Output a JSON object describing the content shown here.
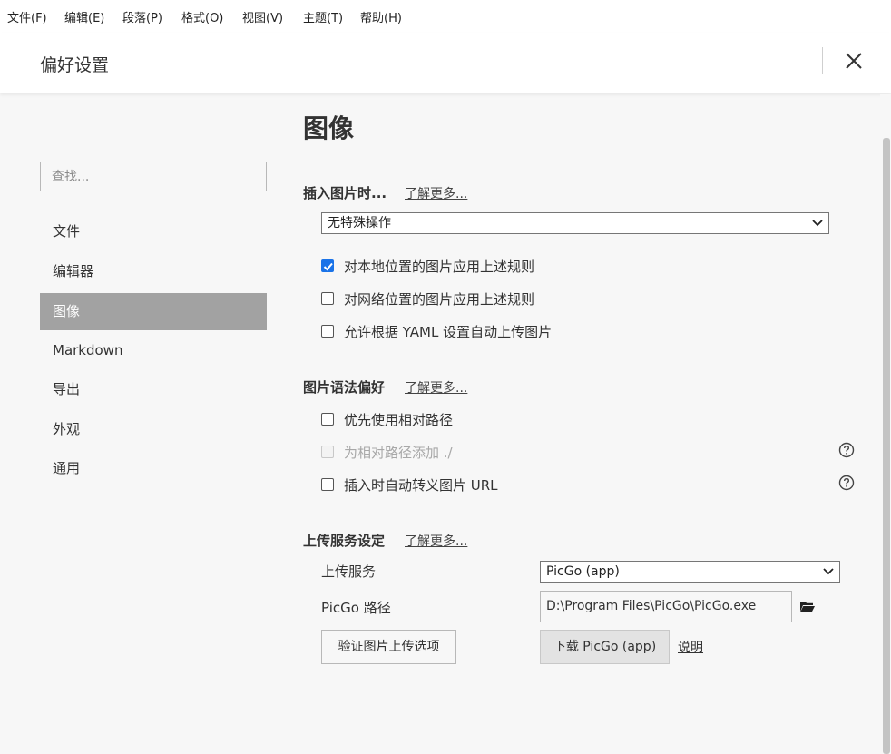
{
  "menubar": {
    "items": [
      "文件(F)",
      "编辑(E)",
      "段落(P)",
      "格式(O)",
      "视图(V)",
      "主题(T)",
      "帮助(H)"
    ]
  },
  "header": {
    "title": "偏好设置",
    "close_icon": "close-icon"
  },
  "sidebar": {
    "search_placeholder": "查找...",
    "items": [
      {
        "label": "文件",
        "active": false
      },
      {
        "label": "编辑器",
        "active": false
      },
      {
        "label": "图像",
        "active": true
      },
      {
        "label": "Markdown",
        "active": false
      },
      {
        "label": "导出",
        "active": false
      },
      {
        "label": "外观",
        "active": false
      },
      {
        "label": "通用",
        "active": false
      }
    ],
    "active_color": "#a2a2a2"
  },
  "main": {
    "title": "图像",
    "insert": {
      "heading": "插入图片时...",
      "learn_more": "了解更多...",
      "action_select": "无特殊操作",
      "options": [
        {
          "label": "对本地位置的图片应用上述规则",
          "checked": true,
          "disabled": false
        },
        {
          "label": "对网络位置的图片应用上述规则",
          "checked": false,
          "disabled": false
        },
        {
          "label": "允许根据 YAML 设置自动上传图片",
          "checked": false,
          "disabled": false
        }
      ]
    },
    "syntax": {
      "heading": "图片语法偏好",
      "learn_more": "了解更多...",
      "options": [
        {
          "label": "优先使用相对路径",
          "checked": false,
          "disabled": false,
          "help": false
        },
        {
          "label": "为相对路径添加 ./",
          "checked": false,
          "disabled": true,
          "help": true
        },
        {
          "label": "插入时自动转义图片 URL",
          "checked": false,
          "disabled": false,
          "help": true
        }
      ],
      "help_icon": "question-circle-icon"
    },
    "upload": {
      "heading": "上传服务设定",
      "learn_more": "了解更多...",
      "service_label": "上传服务",
      "service_value": "PicGo (app)",
      "path_label": "PicGo 路径",
      "path_value": "D:\\Program Files\\PicGo\\PicGo.exe",
      "folder_icon": "folder-icon",
      "verify_button": "验证图片上传选项",
      "download_button": "下载 PicGo (app)",
      "help_link": "说明"
    }
  },
  "colors": {
    "accent": "#1a73e8",
    "background": "#f7f7f7"
  }
}
